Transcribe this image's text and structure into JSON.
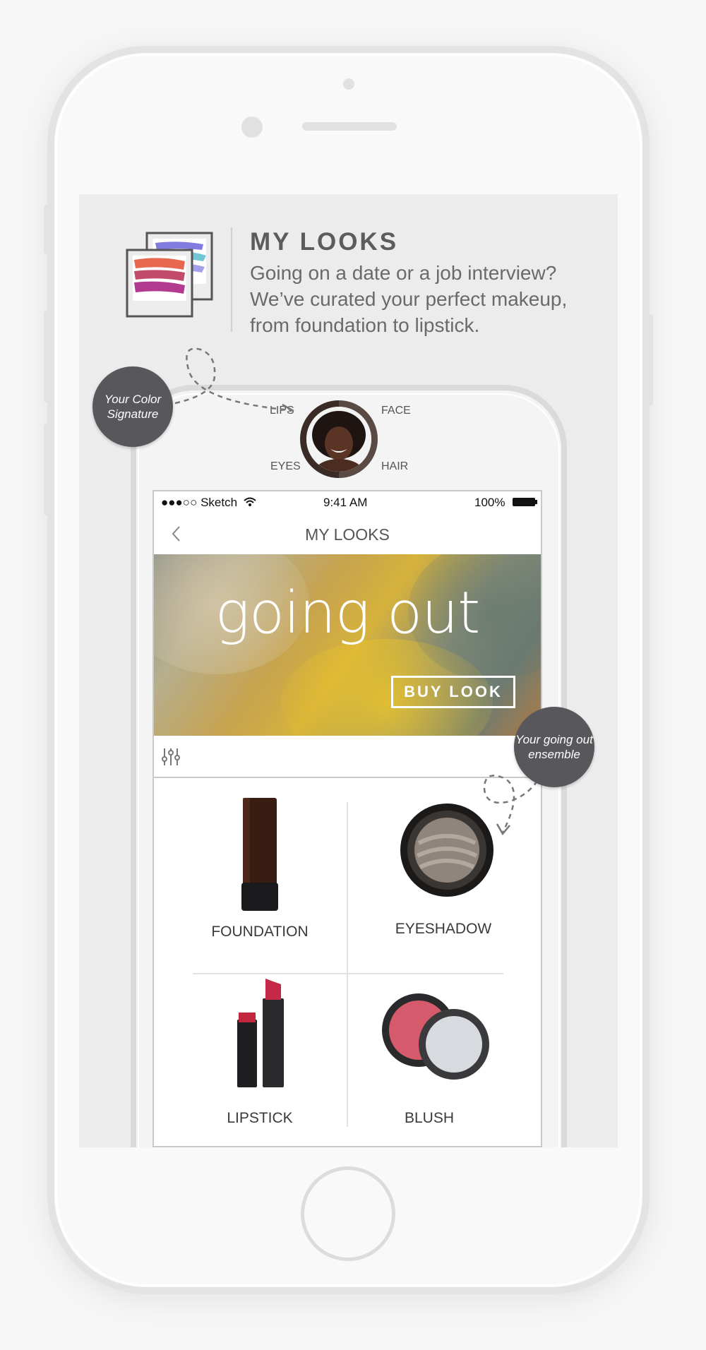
{
  "header": {
    "title": "MY LOOKS",
    "description": "Going on a date or a job interview? We’ve curated your perfect makeup, from foundation to lipstick."
  },
  "callouts": {
    "color_signature": "Your Color Signature",
    "going_out": "Your going out ensemble"
  },
  "profile_categories": {
    "lips": "LIPS",
    "face": "FACE",
    "eyes": "EYES",
    "hair": "HAIR"
  },
  "status_bar": {
    "carrier": "●●●○○ Sketch",
    "time": "9:41 AM",
    "battery": "100%"
  },
  "nav": {
    "title": "MY LOOKS"
  },
  "hero": {
    "title": "going out",
    "button": "BUY LOOK"
  },
  "products": [
    {
      "label": "FOUNDATION"
    },
    {
      "label": "EYESHADOW"
    },
    {
      "label": "LIPSTICK"
    },
    {
      "label": "BLUSH"
    }
  ],
  "colors": {
    "screen_bg": "#ececec",
    "bubble": "#58585c",
    "text_dark": "#5c5c5e"
  }
}
